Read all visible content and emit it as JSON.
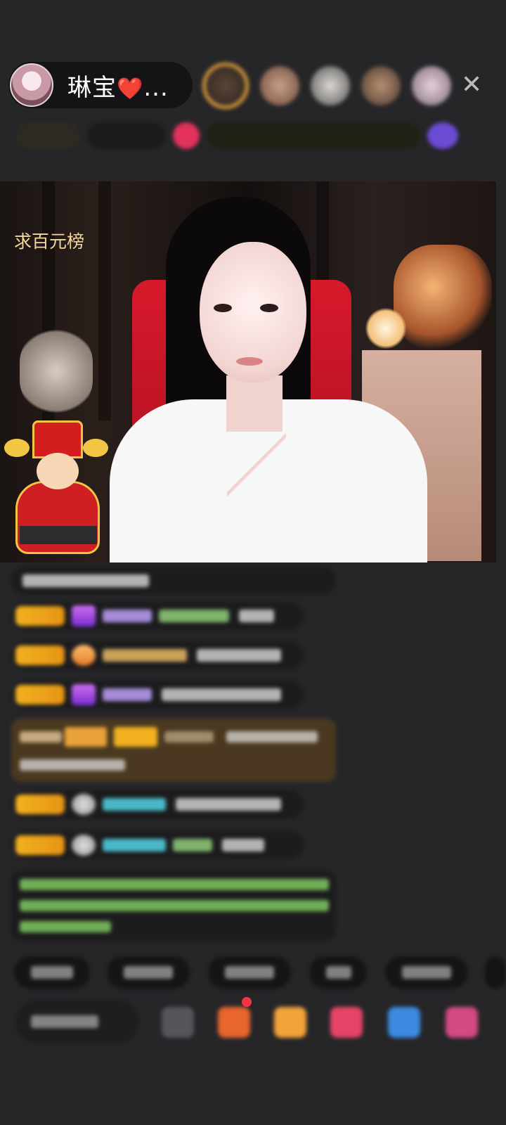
{
  "header": {
    "host_name": "琳宝",
    "host_heart": "❤️",
    "host_ellipsis": "...",
    "close_label": "✕"
  },
  "video": {
    "caption": "求百元榜"
  },
  "colors": {
    "background": "#262629",
    "badge_gold": "#f2b11f",
    "gift_row": "#4a3920",
    "chair_red": "#d7192b"
  },
  "icons": {
    "close": "close-icon",
    "gift_notification": "gift-icon"
  }
}
